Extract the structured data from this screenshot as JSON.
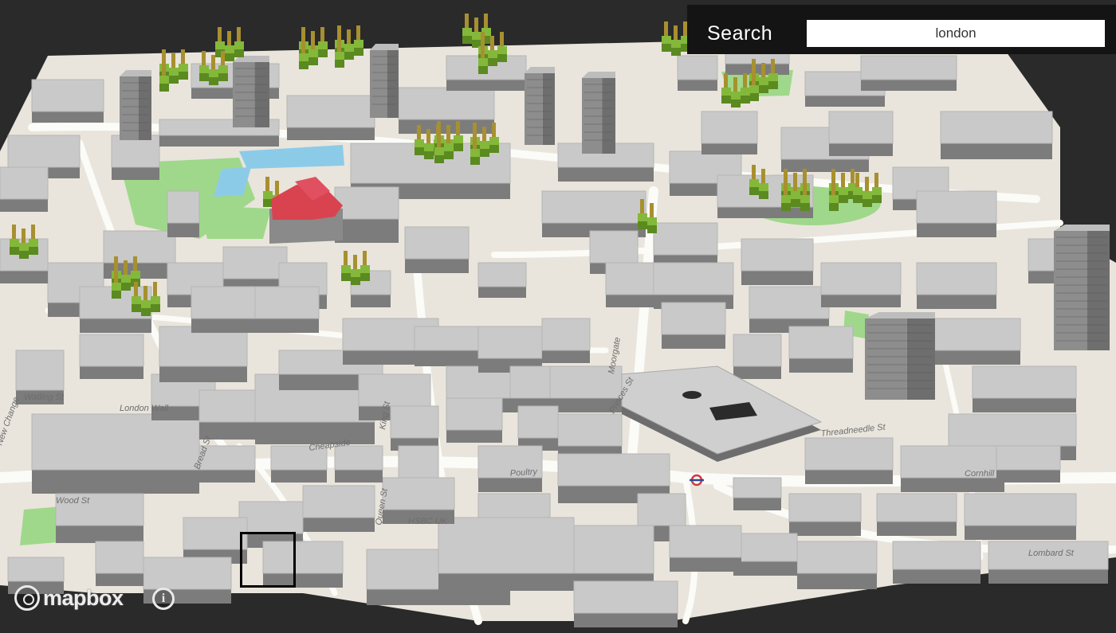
{
  "search": {
    "label": "Search",
    "value": "london"
  },
  "map": {
    "attribution": "mapbox",
    "street_labels": [
      "Cheapside",
      "Threadneedle St",
      "Cornhill",
      "Lombard St",
      "Poultry",
      "Queen St",
      "HSBC UK",
      "King St",
      "Moorgate",
      "Bread St",
      "Wood St",
      "Princes St",
      "New Change",
      "Watling St",
      "London Wall"
    ],
    "selected_building_color": "#d9434f",
    "park_color": "#9fd88a",
    "water_color": "#8ccbe8",
    "tree_color": "#6a9a2c"
  },
  "icons": {
    "logo": "mapbox-logo-icon",
    "info": "info-icon"
  }
}
